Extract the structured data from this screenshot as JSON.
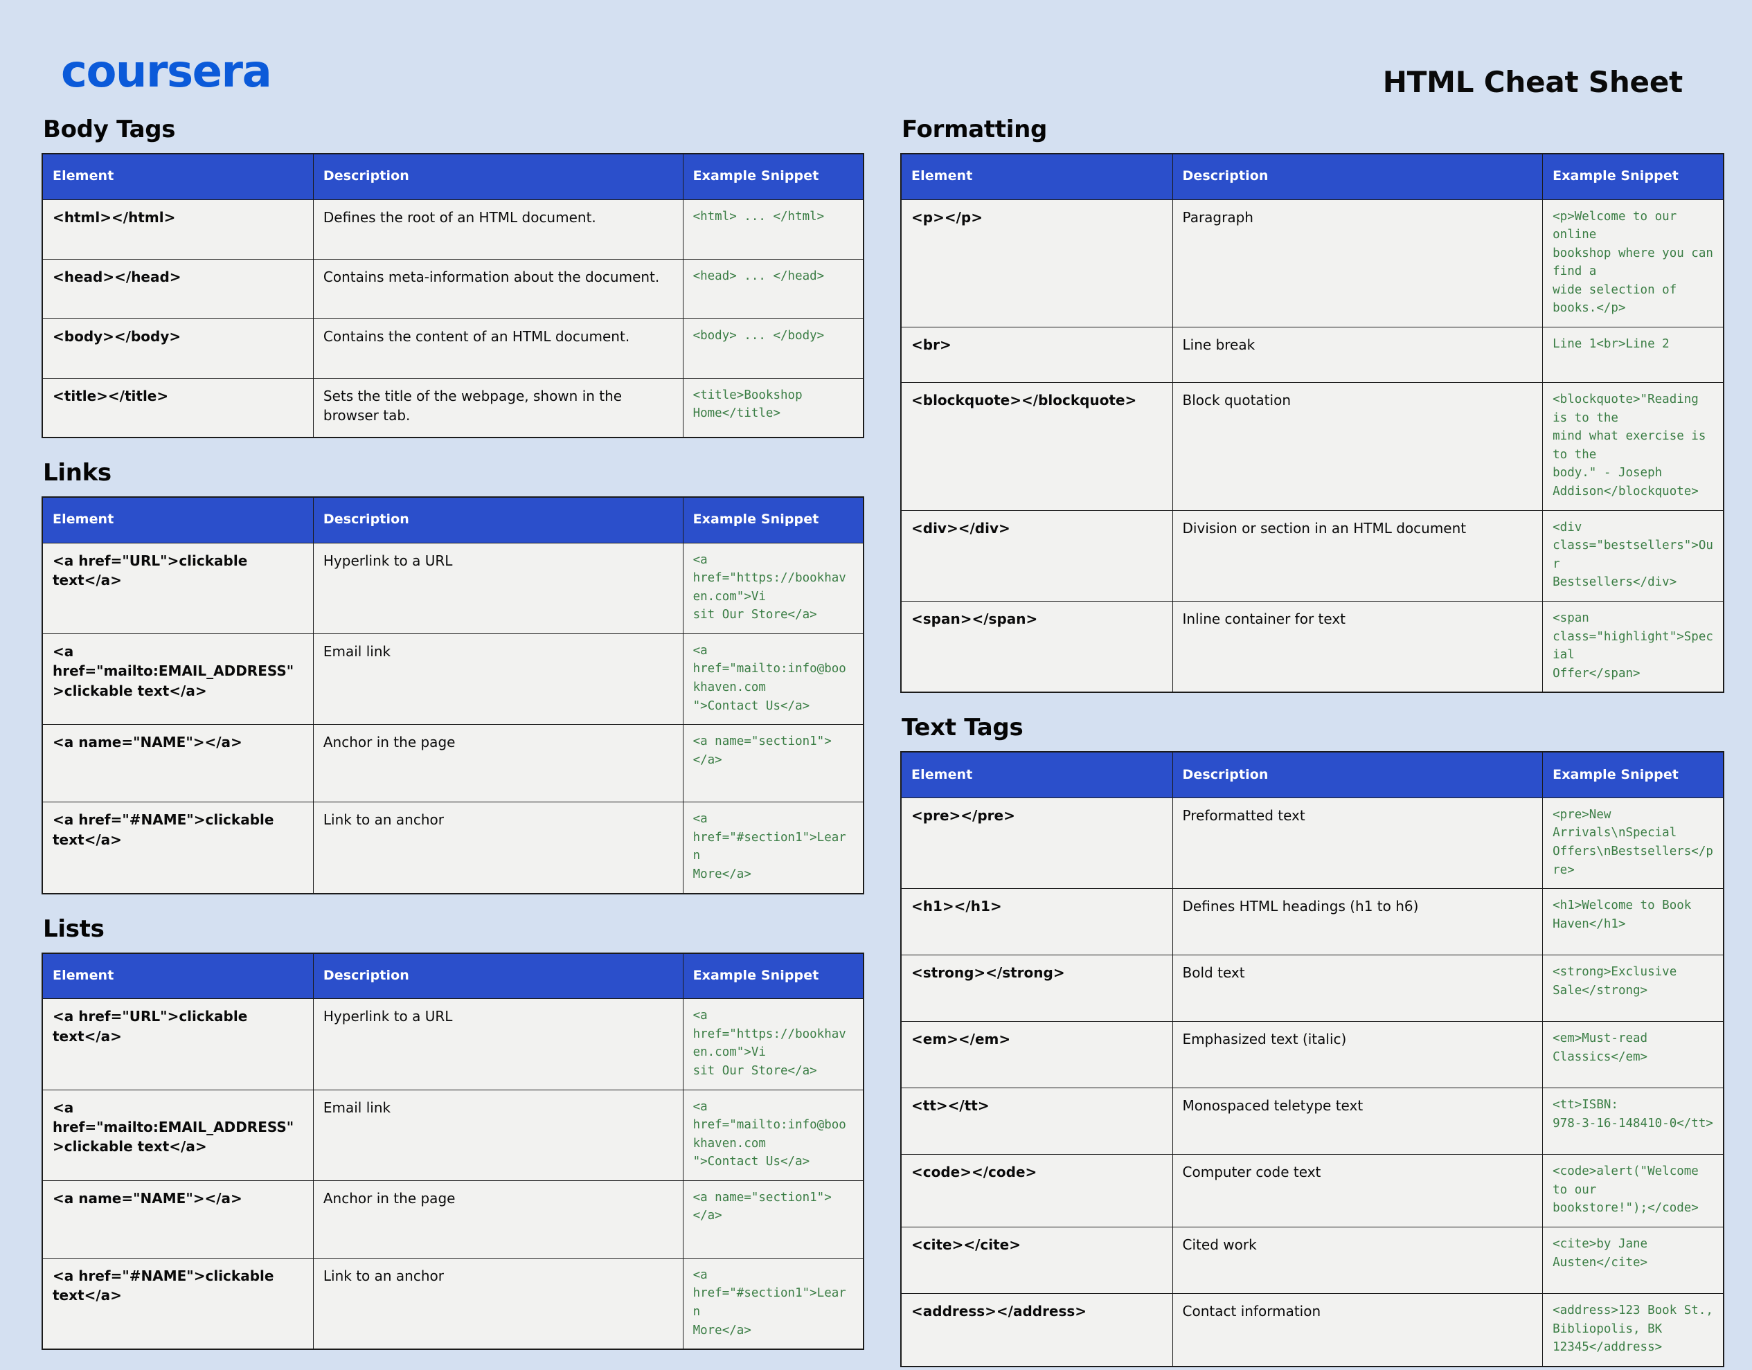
{
  "brand": {
    "logo_text": "coursera",
    "logo_color": "#0b5ad9"
  },
  "header": {
    "title": "HTML Cheat Sheet"
  },
  "theme": {
    "background": "#d4e0f1",
    "table_header_bg": "#2b4fcb",
    "table_header_text": "#ffffff",
    "cell_bg": "#f2f2f0",
    "border": "#1b1b1b",
    "code_color": "#3a7d44",
    "text_color": "#0a0a0a"
  },
  "columns": {
    "headers": {
      "element": "Element",
      "description": "Description",
      "snippet": "Example Snippet"
    }
  },
  "sections": [
    {
      "id": "body-tags",
      "title": "Body Tags",
      "column": "left",
      "rows": [
        {
          "element": "<html></html>",
          "description": "Defines the root of an HTML document.",
          "snippet": "<html> ... </html>"
        },
        {
          "element": "<head></head>",
          "description": "Contains meta-information about the document.",
          "snippet": "<head> ... </head>"
        },
        {
          "element": "<body></body>",
          "description": "Contains the content of an HTML document.",
          "snippet": "<body> ... </body>"
        },
        {
          "element": "<title></title>",
          "description": "Sets the title of the webpage, shown in the browser tab.",
          "snippet": "<title>Bookshop Home</title>"
        }
      ]
    },
    {
      "id": "links",
      "title": "Links",
      "column": "left",
      "rows": [
        {
          "element": "<a href=\"URL\">clickable text</a>",
          "description": "Hyperlink to a URL",
          "snippet": "<a\nhref=\"https://bookhaven.com\">Vi\nsit Our Store</a>"
        },
        {
          "element": "<a href=\"mailto:EMAIL_ADDRESS\">clickable text</a>",
          "description": "Email link",
          "snippet": "<a\nhref=\"mailto:info@bookhaven.com\n\">Contact Us</a>"
        },
        {
          "element": "<a name=\"NAME\"></a>",
          "description": "Anchor in the page",
          "snippet": "<a name=\"section1\"></a>"
        },
        {
          "element": "<a href=\"#NAME\">clickable text</a>",
          "description": "Link to an anchor",
          "snippet": "<a href=\"#section1\">Learn\nMore</a>"
        }
      ]
    },
    {
      "id": "lists",
      "title": "Lists",
      "column": "left",
      "rows": [
        {
          "element": "<a href=\"URL\">clickable text</a>",
          "description": "Hyperlink to a URL",
          "snippet": "<a\nhref=\"https://bookhaven.com\">Vi\nsit Our Store</a>"
        },
        {
          "element": "<a href=\"mailto:EMAIL_ADDRESS\">clickable text</a>",
          "description": "Email link",
          "snippet": "<a\nhref=\"mailto:info@bookhaven.com\n\">Contact Us</a>"
        },
        {
          "element": "<a name=\"NAME\"></a>",
          "description": "Anchor in the page",
          "snippet": "<a name=\"section1\"></a>"
        },
        {
          "element": "<a href=\"#NAME\">clickable text</a>",
          "description": "Link to an anchor",
          "snippet": "<a href=\"#section1\">Learn\nMore</a>"
        }
      ]
    },
    {
      "id": "formatting",
      "title": "Formatting",
      "column": "right",
      "rows": [
        {
          "element": "<p></p>",
          "description": "Paragraph",
          "snippet": "<p>Welcome to our online\nbookshop where you can find a\nwide selection of books.</p>"
        },
        {
          "element": "<br>",
          "description": "Line break",
          "snippet": "Line 1<br>Line 2"
        },
        {
          "element": "<blockquote></blockquote>",
          "description": "Block quotation",
          "snippet": "<blockquote>\"Reading is to the\nmind what exercise is to the\nbody.\" - Joseph\nAddison</blockquote>"
        },
        {
          "element": "<div></div>",
          "description": "Division or section in an HTML document",
          "snippet": "<div class=\"bestsellers\">Our\nBestsellers</div>"
        },
        {
          "element": "<span></span>",
          "description": "Inline container for text",
          "snippet": "<span class=\"highlight\">Special\nOffer</span>"
        }
      ]
    },
    {
      "id": "text-tags",
      "title": "Text Tags",
      "column": "right",
      "rows": [
        {
          "element": "<pre></pre>",
          "description": "Preformatted text",
          "snippet": "<pre>New Arrivals\\nSpecial\nOffers\\nBestsellers</pre>"
        },
        {
          "element": "<h1></h1>",
          "description": "Defines HTML headings (h1 to h6)",
          "snippet": "<h1>Welcome to Book Haven</h1>"
        },
        {
          "element": "<strong></strong>",
          "description": "Bold text",
          "snippet": "<strong>Exclusive Sale</strong>"
        },
        {
          "element": "<em></em>",
          "description": "Emphasized text (italic)",
          "snippet": "<em>Must-read Classics</em>"
        },
        {
          "element": "<tt></tt>",
          "description": "Monospaced teletype text",
          "snippet": "<tt>ISBN:\n978-3-16-148410-0</tt>"
        },
        {
          "element": "<code></code>",
          "description": "Computer code text",
          "snippet": "<code>alert(\"Welcome to our\nbookstore!\");</code>"
        },
        {
          "element": "<cite></cite>",
          "description": "Cited work",
          "snippet": "<cite>by Jane Austen</cite>"
        },
        {
          "element": "<address></address>",
          "description": "Contact information",
          "snippet": "<address>123 Book St.,\nBibliopolis, BK 12345</address>"
        }
      ]
    }
  ]
}
